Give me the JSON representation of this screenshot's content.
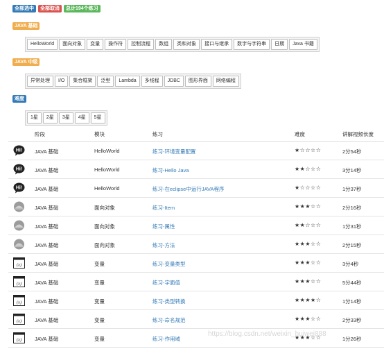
{
  "actions": {
    "select_all": "全部选中",
    "cancel_all": "全部取消",
    "total": "总计194个练习"
  },
  "sections": {
    "basic": {
      "label": "JAVA 基础",
      "items": [
        "HelloWorld",
        "面向对象",
        "变量",
        "操作符",
        "控制流程",
        "数组",
        "类和对象",
        "接口与继承",
        "数字与字符串",
        "日期",
        "Java 书籍"
      ]
    },
    "middle": {
      "label": "JAVA 中级",
      "items": [
        "异常处理",
        "I/O",
        "集合框架",
        "泛型",
        "Lambda",
        "多线程",
        "JDBC",
        "图形界面",
        "网络编程"
      ]
    },
    "difficulty": {
      "label": "难度",
      "items": [
        "1星",
        "2星",
        "3星",
        "4星",
        "5星"
      ]
    }
  },
  "table": {
    "headers": {
      "stage": "阶段",
      "module": "模块",
      "exercise": "练习",
      "difficulty": "难度",
      "duration": "讲解视频长度"
    },
    "rows": [
      {
        "icon": "hi-icon",
        "stage": "JAVA 基础",
        "module": "HelloWorld",
        "exercise": "练习-环境变量配置",
        "stars": "★☆☆☆☆",
        "duration": "2分54秒"
      },
      {
        "icon": "hi-icon",
        "stage": "JAVA 基础",
        "module": "HelloWorld",
        "exercise": "练习-Hello Java",
        "stars": "★★☆☆☆",
        "duration": "3分14秒"
      },
      {
        "icon": "hi-icon",
        "stage": "JAVA 基础",
        "module": "HelloWorld",
        "exercise": "练习-在eclipse中运行JAVA程序",
        "stars": "★☆☆☆☆",
        "duration": "1分37秒"
      },
      {
        "icon": "object-icon",
        "stage": "JAVA 基础",
        "module": "面向对象",
        "exercise": "练习-Item",
        "stars": "★★★☆☆",
        "duration": "2分16秒"
      },
      {
        "icon": "object-icon",
        "stage": "JAVA 基础",
        "module": "面向对象",
        "exercise": "练习-属性",
        "stars": "★★☆☆☆",
        "duration": "1分31秒"
      },
      {
        "icon": "object-icon",
        "stage": "JAVA 基础",
        "module": "面向对象",
        "exercise": "练习-方法",
        "stars": "★★★☆☆",
        "duration": "2分15秒"
      },
      {
        "icon": "variable-icon",
        "stage": "JAVA 基础",
        "module": "变量",
        "exercise": "练习-变量类型",
        "stars": "★★★☆☆",
        "duration": "3分4秒"
      },
      {
        "icon": "variable-icon",
        "stage": "JAVA 基础",
        "module": "变量",
        "exercise": "练习-字面值",
        "stars": "★★★☆☆",
        "duration": "5分44秒"
      },
      {
        "icon": "variable-icon",
        "stage": "JAVA 基础",
        "module": "变量",
        "exercise": "练习-类型转换",
        "stars": "★★★★☆",
        "duration": "1分14秒"
      },
      {
        "icon": "variable-icon",
        "stage": "JAVA 基础",
        "module": "变量",
        "exercise": "练习-命名规范",
        "stars": "★★★☆☆",
        "duration": "2分33秒"
      },
      {
        "icon": "variable-icon",
        "stage": "JAVA 基础",
        "module": "变量",
        "exercise": "练习-作用域",
        "stars": "★★★☆☆",
        "duration": "1分26秒"
      }
    ]
  },
  "watermark": "https://blog.csdn.net/weixin_huiwei888"
}
